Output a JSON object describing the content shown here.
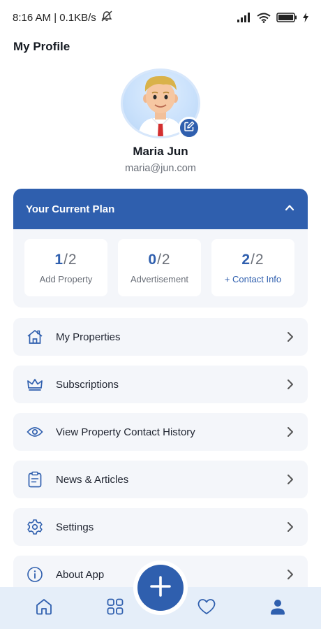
{
  "status_bar": {
    "time_speed": "8:16 AM | 0.1KB/s",
    "icons": [
      "mute-icon",
      "signal-icon",
      "wifi-icon",
      "battery-icon",
      "charging-icon"
    ]
  },
  "page": {
    "title": "My Profile"
  },
  "profile": {
    "name": "Maria Jun",
    "email": "maria@jun.com"
  },
  "plan": {
    "title": "Your Current Plan",
    "expanded": true,
    "stats": [
      {
        "used": "1",
        "total": "2",
        "label": "Add Property"
      },
      {
        "used": "0",
        "total": "2",
        "label": "Advertisement"
      },
      {
        "used": "2",
        "total": "2",
        "label": "+ Contact Info"
      }
    ]
  },
  "menu": {
    "items": [
      {
        "label": "My Properties",
        "icon": "home-icon"
      },
      {
        "label": "Subscriptions",
        "icon": "crown-icon"
      },
      {
        "label": "View Property Contact History",
        "icon": "eye-icon"
      },
      {
        "label": "News & Articles",
        "icon": "clipboard-icon"
      },
      {
        "label": "Settings",
        "icon": "gear-icon"
      },
      {
        "label": "About App",
        "icon": "info-icon"
      }
    ]
  },
  "bottom_nav": {
    "items": [
      "home-icon",
      "grid-icon",
      "heart-icon",
      "profile-icon"
    ],
    "active": "profile-icon",
    "fab_icon": "plus-icon"
  },
  "colors": {
    "primary": "#2f5fae",
    "card_bg": "#f4f6fa",
    "nav_bg": "#e5eef9",
    "text_muted": "#6a6f78"
  }
}
